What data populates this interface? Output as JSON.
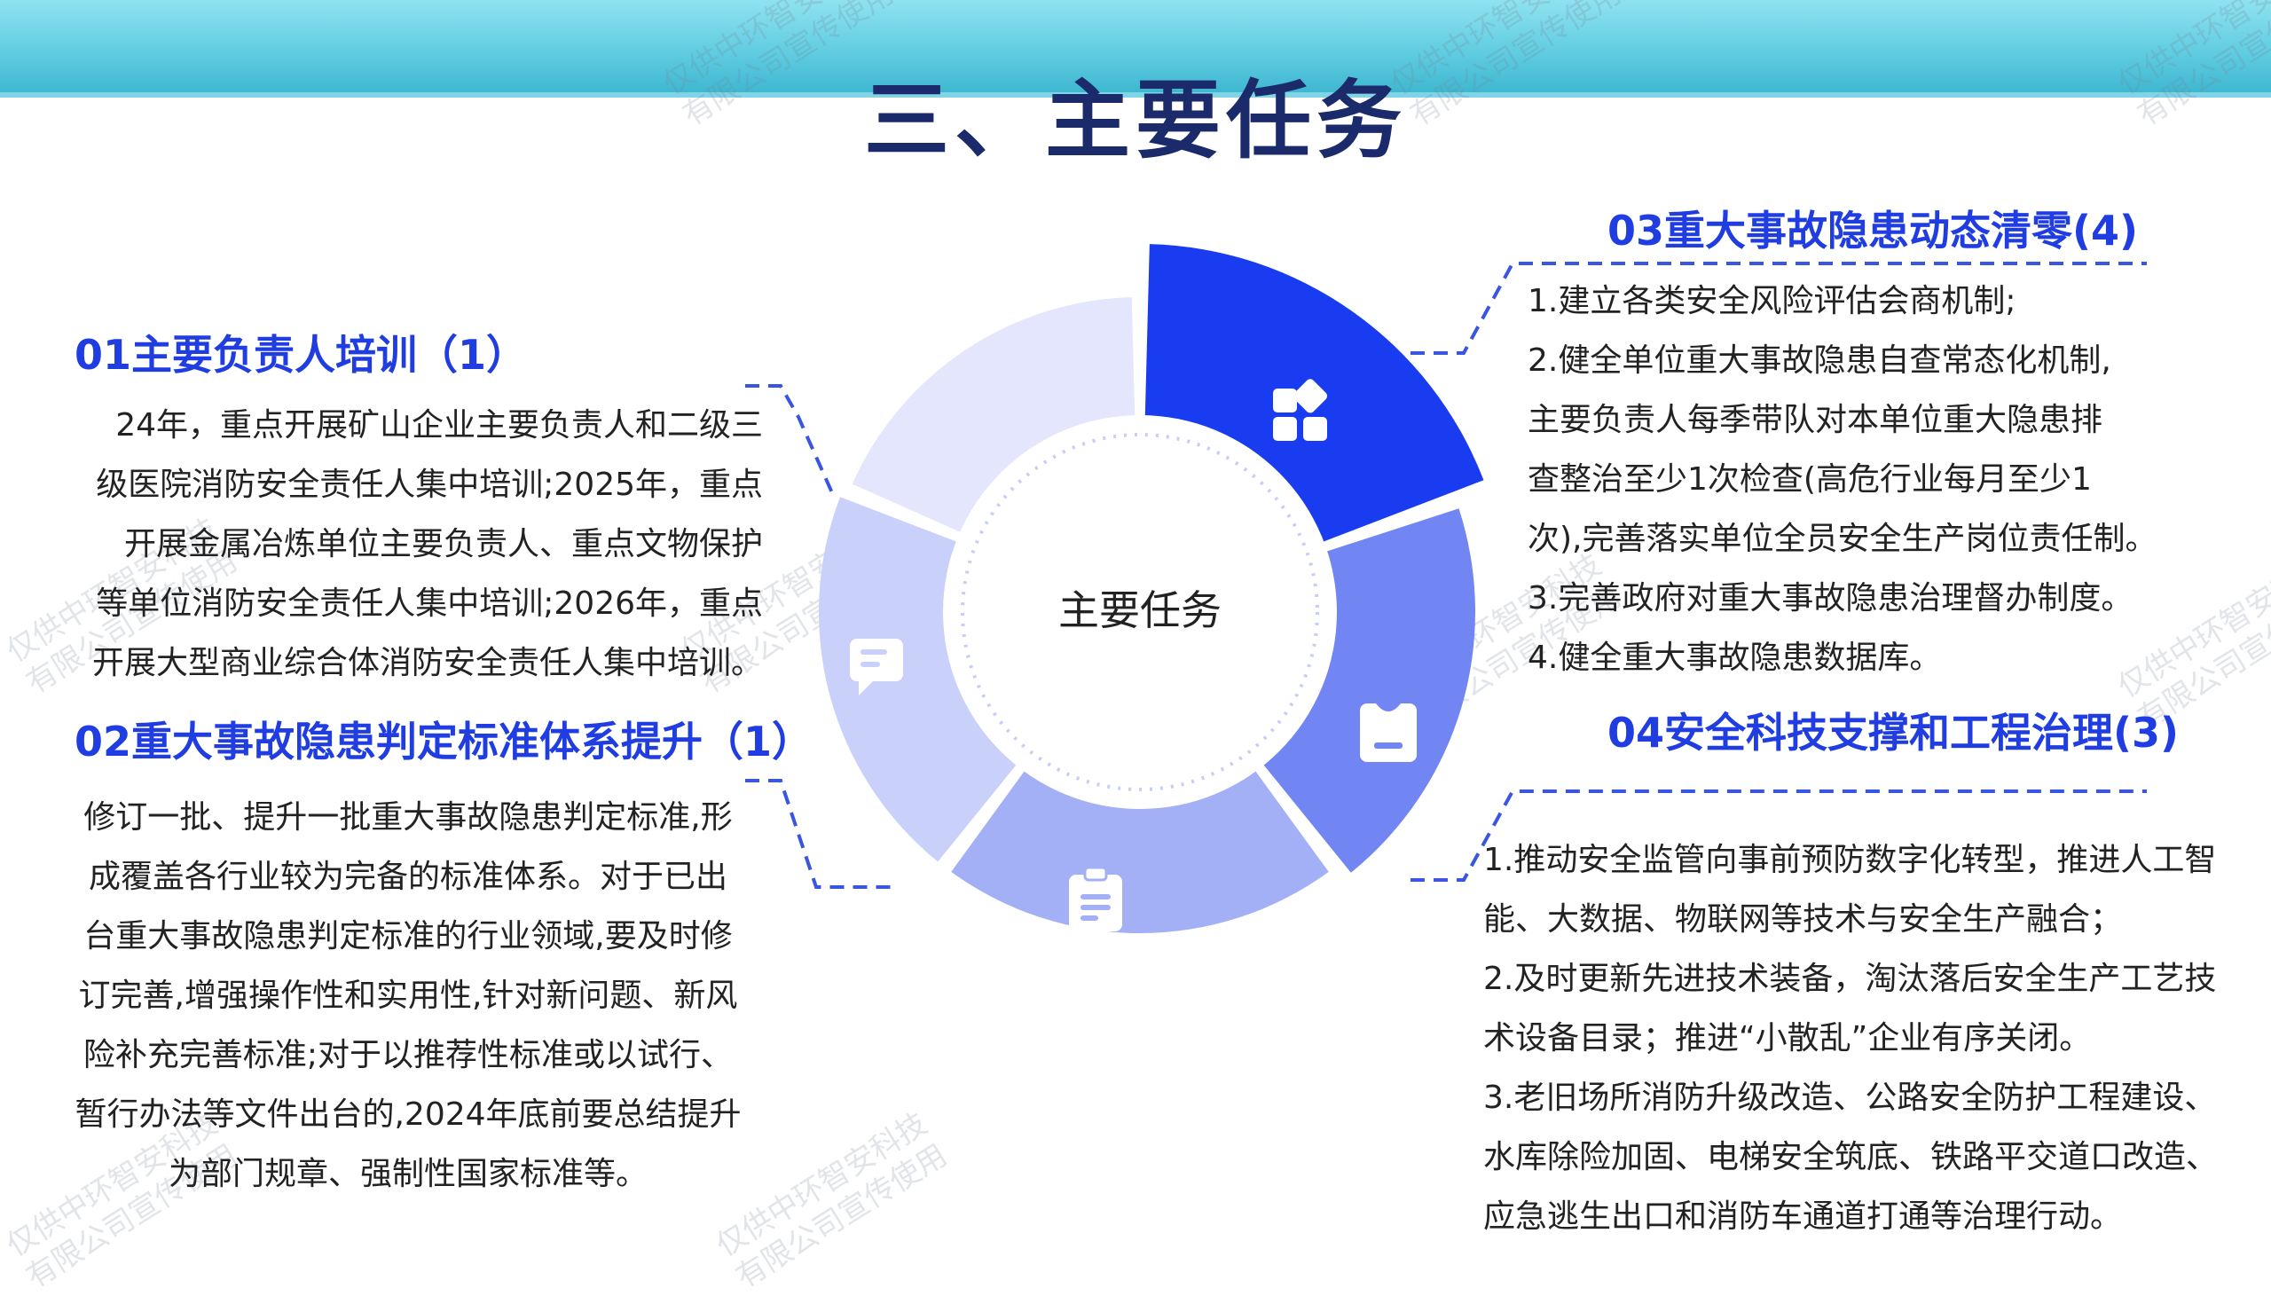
{
  "title": "三、主要任务",
  "center_label": "主要任务",
  "watermark": [
    "仅供中环智安科技",
    "有限公司宣传使用"
  ],
  "colors": {
    "accent": "#1f3de0",
    "seg1": "#1a3cf0",
    "seg2": "#7286f3",
    "seg3": "#a3b0f6",
    "seg4": "#c9d0fa",
    "seg5": "#e3e6fc"
  },
  "icons": [
    "apps-icon",
    "tag-icon",
    "clipboard-icon",
    "chat-icon"
  ],
  "sections": [
    {
      "title": "01主要负责人培训（1）",
      "lines": [
        "24年，重点开展矿山企业主要负责人和二级三",
        "级医院消防安全责任人集中培训;2025年，重点",
        "开展金属冶炼单位主要负责人、重点文物保护",
        "等单位消防安全责任人集中培训;2026年，重点",
        "开展大型商业综合体消防安全责任人集中培训。"
      ]
    },
    {
      "title": "02重大事故隐患判定标准体系提升（1）",
      "lines": [
        "修订一批、提升一批重大事故隐患判定标准,形",
        "成覆盖各行业较为完备的标准体系。对于已出",
        "台重大事故隐患判定标准的行业领域,要及时修",
        "订完善,增强操作性和实用性,针对新问题、新风",
        "险补充完善标准;对于以推荐性标准或以试行、",
        "暂行办法等文件出台的,2024年底前要总结提升",
        "为部门规章、强制性国家标准等。"
      ]
    },
    {
      "title": "03重大事故隐患动态清零(4)",
      "lines": [
        "1.建立各类安全风险评估会商机制;",
        "2.健全单位重大事故隐患自查常态化机制,",
        "主要负责人每季带队对本单位重大隐患排",
        "查整治至少1次检查(高危行业每月至少1",
        "次),完善落实单位全员安全生产岗位责任制。",
        "3.完善政府对重大事故隐患治理督办制度。",
        "4.健全重大事故隐患数据库。"
      ]
    },
    {
      "title": "04安全科技支撑和工程治理(3)",
      "lines": [
        "1.推动安全监管向事前预防数字化转型，推进人工智",
        "能、大数据、物联网等技术与安全生产融合；",
        "2.及时更新先进技术装备，淘汰落后安全生产工艺技",
        "术设备目录；推进“小散乱”企业有序关闭。",
        "3.老旧场所消防升级改造、公路安全防护工程建设、",
        "水库除险加固、电梯安全筑底、铁路平交道口改造、",
        "应急逃生出口和消防车通道打通等治理行动。"
      ]
    }
  ]
}
